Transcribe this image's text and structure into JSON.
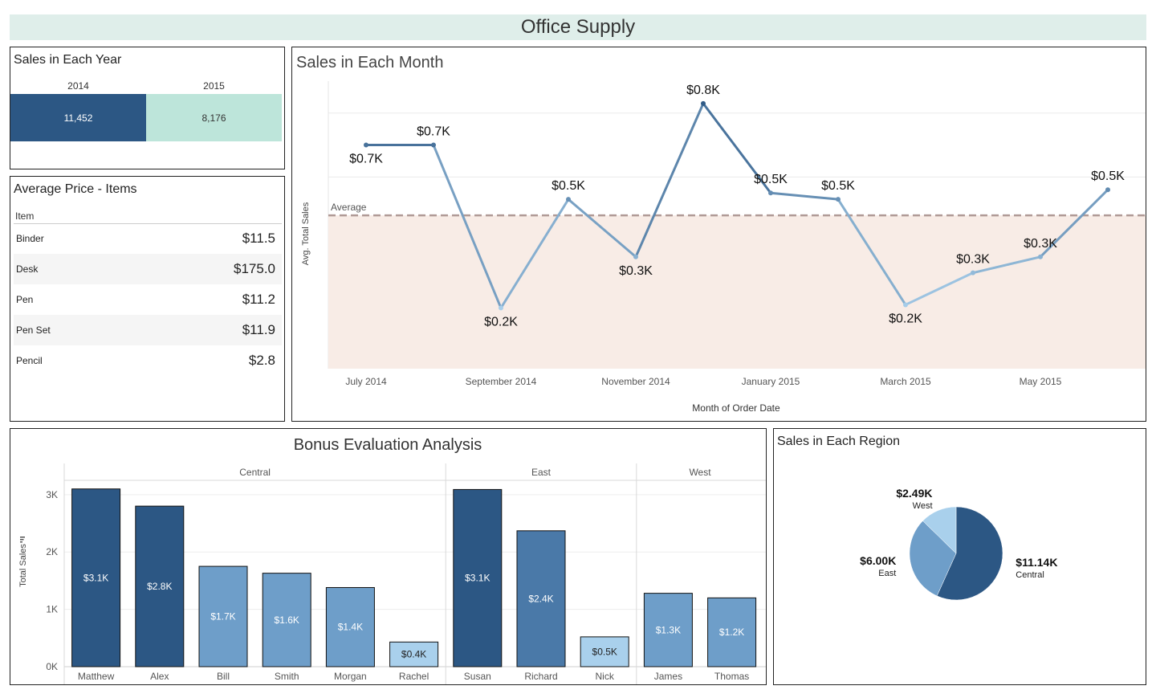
{
  "title": "Office Supply",
  "colors": {
    "dark_blue": "#2c5784",
    "mid_blue": "#4a79a8",
    "light_blue": "#6e9ec9",
    "pale_blue": "#a9d0ec",
    "mint": "#bde5da",
    "title_bg": "#dfeeea",
    "avg_band": "#f8ece6",
    "avg_line": "#b09a96"
  },
  "year_panel": {
    "title": "Sales in Each Year",
    "chart_data": {
      "type": "table",
      "title": "Sales in Each Year",
      "columns": [
        "2014",
        "2015"
      ],
      "values": [
        11452,
        8176
      ],
      "labels": [
        "11,452",
        "8,176"
      ]
    }
  },
  "avg_panel": {
    "title": "Average Price - Items",
    "column_header": "Item",
    "rows": [
      {
        "item": "Binder",
        "price": "$11.5"
      },
      {
        "item": "Desk",
        "price": "$175.0"
      },
      {
        "item": "Pen",
        "price": "$11.2"
      },
      {
        "item": "Pen Set",
        "price": "$11.9"
      },
      {
        "item": "Pencil",
        "price": "$2.8"
      }
    ]
  },
  "month_panel": {
    "title": "Sales in Each Month",
    "chart_data": {
      "type": "line",
      "title": "Sales in Each Month",
      "xlabel": "Month of Order Date",
      "ylabel": "Avg. Total Sales",
      "x": [
        "2014-07",
        "2014-08",
        "2014-09",
        "2014-10",
        "2014-11",
        "2014-12",
        "2015-01",
        "2015-02",
        "2015-03",
        "2015-04",
        "2015-05",
        "2015-06"
      ],
      "x_tick_labels": [
        "July 2014",
        "September 2014",
        "November 2014",
        "January 2015",
        "March 2015",
        "May 2015"
      ],
      "x_tick_months": [
        "2014-07",
        "2014-09",
        "2014-11",
        "2015-01",
        "2015-03",
        "2015-05"
      ],
      "values": [
        700,
        700,
        190,
        530,
        350,
        830,
        550,
        530,
        200,
        300,
        350,
        560
      ],
      "data_labels": [
        "$0.7K",
        "$0.7K",
        "$0.2K",
        "$0.5K",
        "$0.3K",
        "$0.8K",
        "$0.5K",
        "$0.5K",
        "$0.2K",
        "$0.3K",
        "$0.3K",
        "$0.5K"
      ],
      "average": 480,
      "average_label": "Average",
      "ylim": [
        0,
        900
      ],
      "grid": true
    }
  },
  "bonus_panel": {
    "title": "Bonus Evaluation Analysis",
    "chart_data": {
      "type": "bar",
      "title": "Bonus Evaluation Analysis",
      "ylabel": "Total Sales",
      "ylim": [
        0,
        3250
      ],
      "y_ticks": [
        0,
        1000,
        2000,
        3000
      ],
      "y_tick_labels": [
        "0K",
        "1K",
        "2K",
        "3K"
      ],
      "groups": [
        {
          "name": "Central",
          "categories": [
            "Matthew",
            "Alex",
            "Bill",
            "Smith",
            "Morgan",
            "Rachel"
          ],
          "values": [
            3100,
            2800,
            1750,
            1630,
            1380,
            430
          ],
          "labels": [
            "$3.1K",
            "$2.8K",
            "$1.7K",
            "$1.6K",
            "$1.4K",
            "$0.4K"
          ]
        },
        {
          "name": "East",
          "categories": [
            "Susan",
            "Richard",
            "Nick"
          ],
          "values": [
            3090,
            2370,
            520
          ],
          "labels": [
            "$3.1K",
            "$2.4K",
            "$0.5K"
          ]
        },
        {
          "name": "West",
          "categories": [
            "James",
            "Thomas"
          ],
          "values": [
            1280,
            1200
          ],
          "labels": [
            "$1.3K",
            "$1.2K"
          ]
        }
      ]
    }
  },
  "region_panel": {
    "title": "Sales in Each Region",
    "chart_data": {
      "type": "pie",
      "title": "Sales in Each Region",
      "categories": [
        "Central",
        "East",
        "West"
      ],
      "values": [
        11.14,
        6.0,
        2.49
      ],
      "labels": [
        "$11.14K",
        "$6.00K",
        "$2.49K"
      ]
    }
  }
}
